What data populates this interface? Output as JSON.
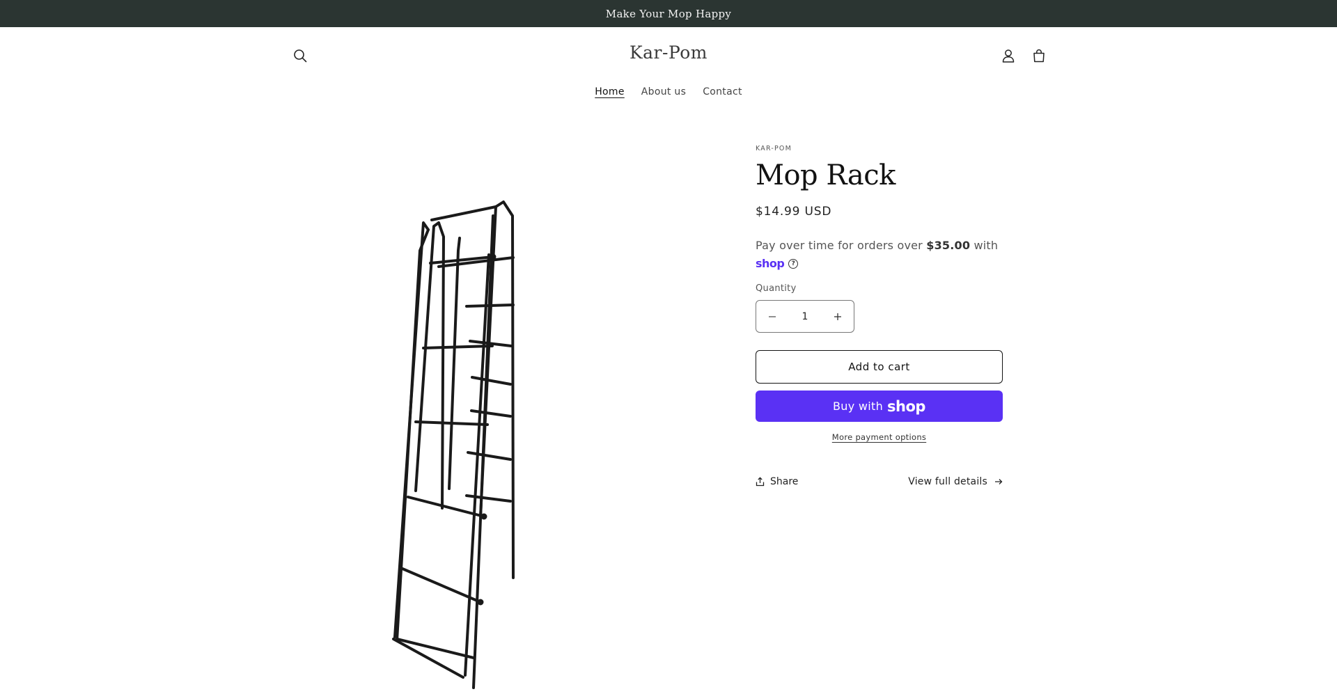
{
  "announcement": {
    "text": "Make Your Mop Happy"
  },
  "header": {
    "logo": "Kar-Pom",
    "icons": {
      "search": "search-icon",
      "account": "account-icon",
      "cart": "cart-icon"
    }
  },
  "nav": {
    "items": [
      {
        "label": "Home",
        "active": true
      },
      {
        "label": "About us",
        "active": false
      },
      {
        "label": "Contact",
        "active": false
      }
    ]
  },
  "product": {
    "vendor": "KAR-POM",
    "title": "Mop Rack",
    "price": "$14.99 USD",
    "image": "mop-rack-image"
  },
  "installments": {
    "prefix": "Pay over time for orders over ",
    "amount": "$35.00",
    "suffix": " with",
    "brand": "shop",
    "help": "?"
  },
  "quantity": {
    "label": "Quantity",
    "value": "1",
    "minus": "−",
    "plus": "+"
  },
  "buttons": {
    "add_to_cart": "Add to cart",
    "buy_with_prefix": "Buy with",
    "buy_with_brand": "shop",
    "more_payment": "More payment options",
    "share": "Share",
    "view_details": "View full details"
  },
  "colors": {
    "announcement_bg": "#2b3532",
    "shop_purple": "#5a31f4",
    "text": "#121212"
  }
}
